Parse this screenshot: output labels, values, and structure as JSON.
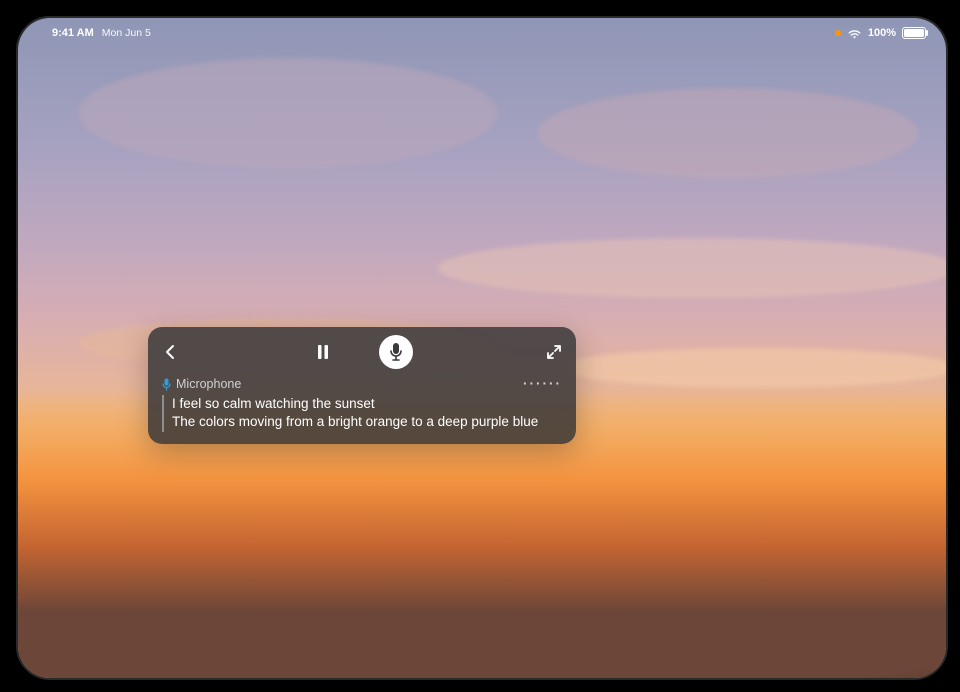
{
  "status": {
    "time": "9:41 AM",
    "date": "Mon Jun 5",
    "battery_pct": "100%"
  },
  "panel": {
    "source_label": "Microphone",
    "line1": "I feel so calm watching the sunset",
    "line2": "The colors moving from a bright orange to a deep purple blue",
    "more_glyph": "······"
  },
  "icons": {
    "back": "back-chevron-icon",
    "pause": "pause-icon",
    "mic": "microphone-icon",
    "expand": "expand-icon",
    "mic_small": "microphone-small-icon",
    "more": "more-icon",
    "wifi": "wifi-icon",
    "battery": "battery-icon",
    "dot": "recording-indicator-dot"
  }
}
